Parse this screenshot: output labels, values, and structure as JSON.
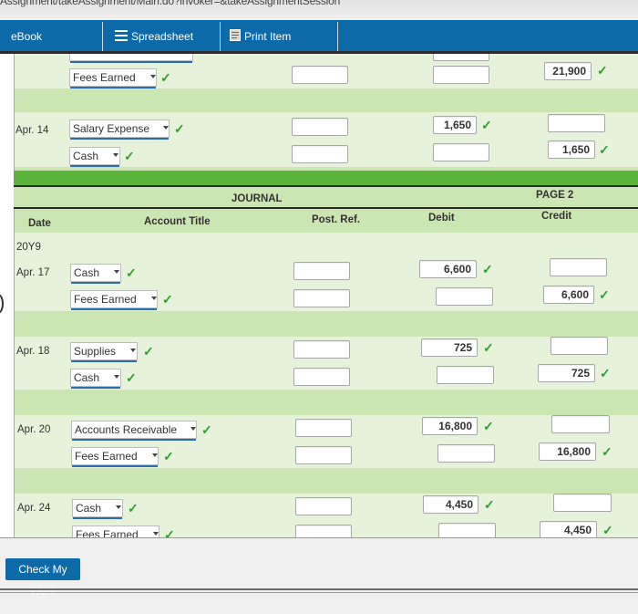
{
  "top_strip": {
    "text": "Assignment/takeAssignment/Main.do?invoker=&takeAssignmentSession"
  },
  "toolbar": {
    "ebook": "eBook",
    "spreadsheet": "Spreadsheet",
    "print": "Print Item"
  },
  "journal_top": {
    "fees_earned_label": "Fees Earned",
    "fees_earned_credit": "21,900",
    "apr14": {
      "date": "Apr. 14",
      "debit_account": "Salary Expense",
      "debit_amount": "1,650",
      "credit_account": "Cash",
      "credit_amount": "1,650"
    }
  },
  "journal_header": {
    "title": "JOURNAL",
    "page": "PAGE 2",
    "col_date": "Date",
    "col_account": "Account Title",
    "col_postref": "Post. Ref.",
    "col_debit": "Debit",
    "col_credit": "Credit"
  },
  "year": "20Y9",
  "entries": [
    {
      "date": "Apr. 17",
      "debit_account": "Cash",
      "debit_amount": "6,600",
      "credit_account": "Fees Earned",
      "credit_amount": "6,600"
    },
    {
      "date": "Apr. 18",
      "debit_account": "Supplies",
      "debit_amount": "725",
      "credit_account": "Cash",
      "credit_amount": "725"
    },
    {
      "date": "Apr. 20",
      "debit_account": "Accounts Receivable",
      "debit_amount": "16,800",
      "credit_account": "Fees Earned",
      "credit_amount": "16,800"
    },
    {
      "date": "Apr. 24",
      "debit_account": "Cash",
      "debit_amount": "4,450",
      "credit_account": "Fees Earned",
      "credit_amount": "4,450"
    }
  ],
  "check_button": "Check My Work",
  "colors": {
    "toolbar": "#0c6aa8",
    "band_light": "#e6f3da",
    "band_mid": "#cbe6b3",
    "green_bar": "#5cb33a",
    "check": "#2e9e2e"
  }
}
